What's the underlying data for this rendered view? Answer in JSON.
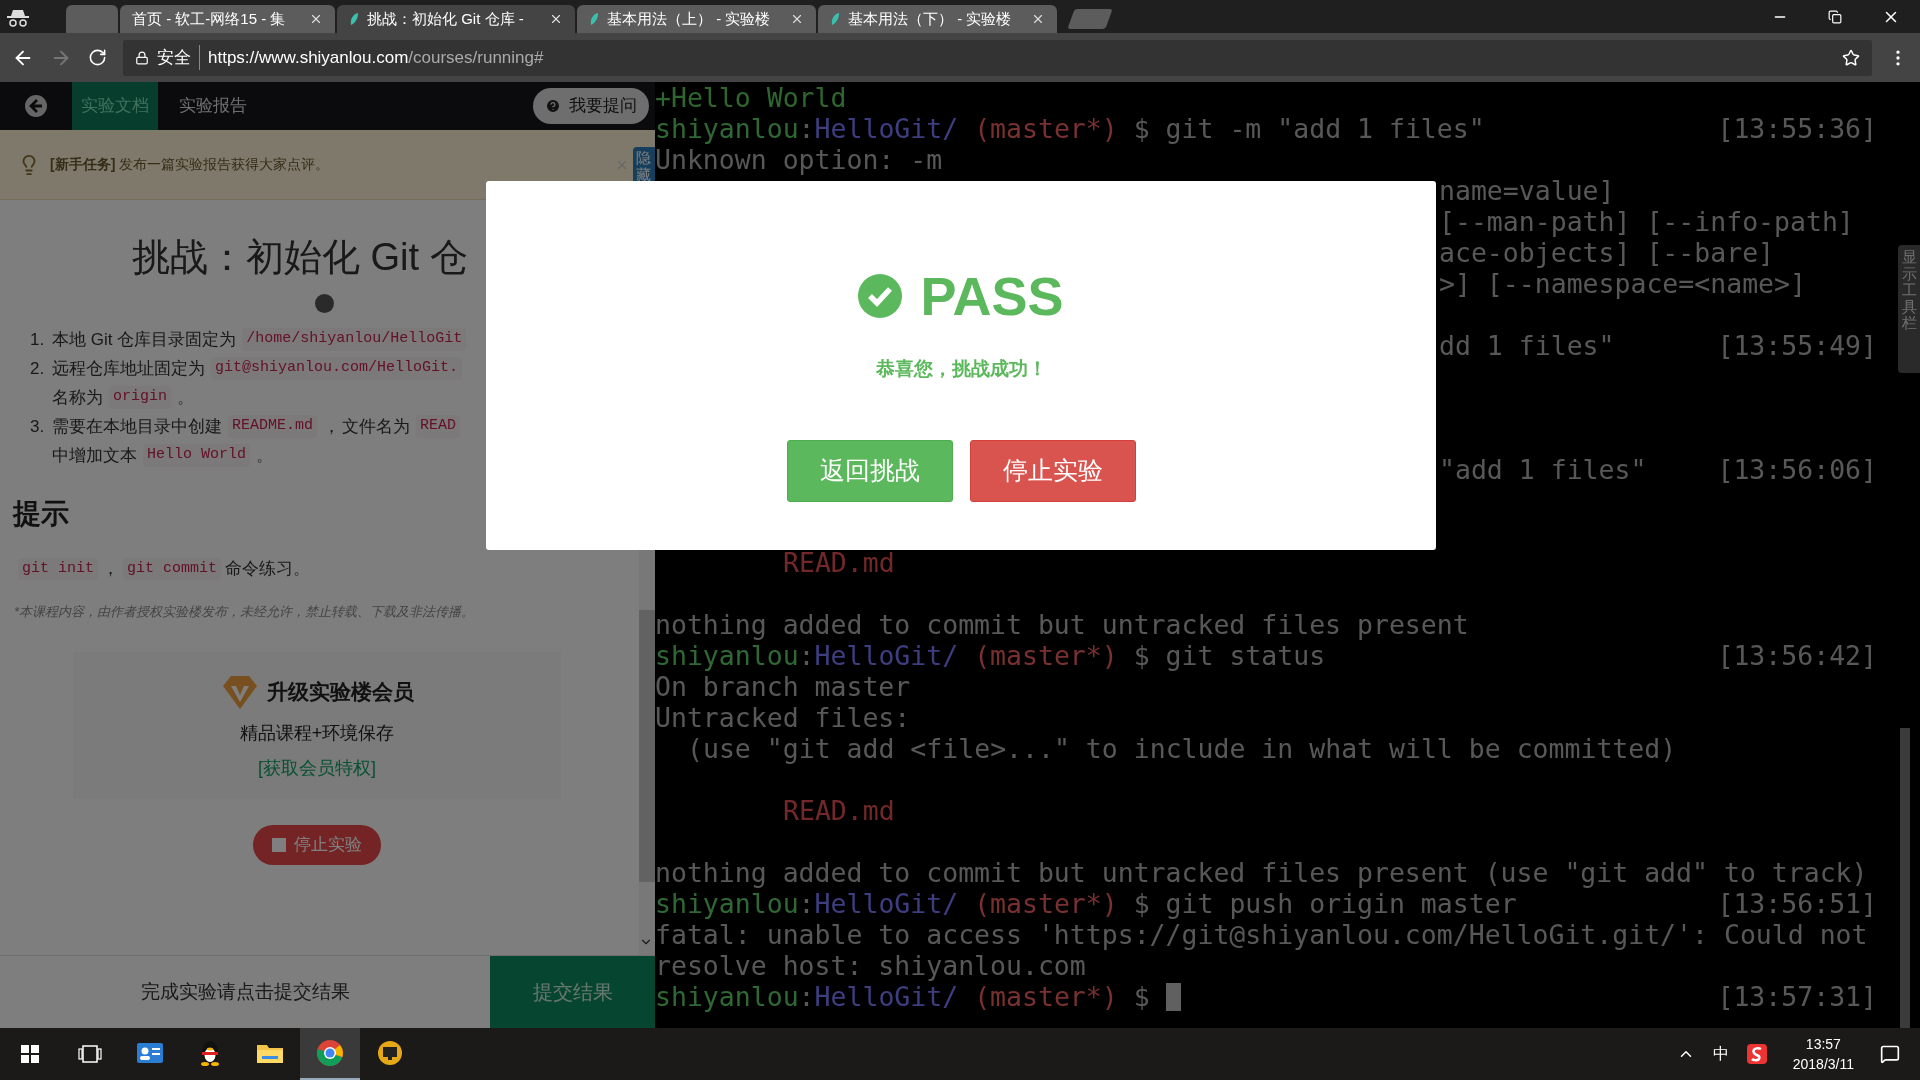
{
  "browser": {
    "tabs": [
      {
        "selected": false,
        "icon": false
      },
      {
        "title": "首页 - 软工-网络15 - 集",
        "selected": false,
        "icon": false
      },
      {
        "title": "挑战：初始化 Git 仓库 -",
        "selected": true,
        "icon": true
      },
      {
        "title": "基本用法（上） - 实验楼",
        "selected": false,
        "icon": true
      },
      {
        "title": "基本用法（下） - 实验楼",
        "selected": false,
        "icon": true
      }
    ],
    "forward_disabled": true,
    "security": "安全",
    "url_host": "https://www.shiyanlou.com",
    "url_path": "/courses/running#"
  },
  "lab_panel": {
    "nav_tabs": [
      {
        "label": "实验文档",
        "selected": true
      },
      {
        "label": "实验报告",
        "selected": false
      }
    ],
    "ask_button": "我要提问",
    "notice": "**[新手任务]** 发布一篇实验报告获得大家点评。",
    "hide_tab": "隐藏",
    "title": "挑战：初始化 Git 仓",
    "steps": [
      {
        "number": "1.",
        "lines": [
          [
            {
              "kind": "text",
              "text": "本地 Git 仓库目录固定为"
            },
            {
              "kind": "code",
              "text": "/home/shiyanlou/HelloGit"
            }
          ]
        ]
      },
      {
        "number": "2.",
        "lines": [
          [
            {
              "kind": "text",
              "text": "远程仓库地址固定为"
            },
            {
              "kind": "code",
              "text": "git@shiyanlou.com/HelloGit."
            }
          ],
          [
            {
              "kind": "text",
              "text": "名称为"
            },
            {
              "kind": "code",
              "text": "origin"
            },
            {
              "kind": "text",
              "text": "。"
            }
          ]
        ]
      },
      {
        "number": "3.",
        "lines": [
          [
            {
              "kind": "text",
              "text": "需要在本地目录中创建"
            },
            {
              "kind": "code",
              "text": "README.md"
            },
            {
              "kind": "text",
              "text": "，"
            },
            {
              "kind": "text",
              "text": "文件名为"
            },
            {
              "kind": "code",
              "text": "READ"
            }
          ],
          [
            {
              "kind": "text",
              "text": "中增加文本"
            },
            {
              "kind": "code",
              "text": "Hello World"
            },
            {
              "kind": "text",
              "text": "。"
            }
          ]
        ]
      }
    ],
    "tips_heading": "提示",
    "tips": [
      {
        "kind": "code",
        "text": "git init"
      },
      {
        "kind": "text",
        "text": "，"
      },
      {
        "kind": "code",
        "text": "git commit"
      },
      {
        "kind": "text",
        "text": "命令练习。"
      }
    ],
    "copyright": "*本课程内容，由作者授权实验楼发布，未经允许，禁止转载、下载及非法传播。",
    "member_card": {
      "title": "升级实验楼会员",
      "subtitle": "精品课程+环境保存",
      "link": "[获取会员特权]"
    },
    "stop_button": "停止实验",
    "footer": {
      "hint": "完成实验请点击提交结果",
      "submit": "提交结果"
    }
  },
  "terminal": {
    "lines": [
      {
        "kind": "added",
        "text": "+Hello World"
      },
      {
        "kind": "prompt",
        "user": "shiyanlou",
        "sep": ":",
        "dir": "HelloGit/",
        "branch": "(master*)",
        "command": "$ git -m \"add 1 files\"",
        "time": "[13:55:36]",
        "cursor": false
      },
      {
        "kind": "output",
        "text": "Unknown option: -m"
      },
      {
        "kind": "partial",
        "text": "name=value]"
      },
      {
        "kind": "partial",
        "text": "[--man-path] [--info-path]"
      },
      {
        "kind": "partial",
        "text": "ace-objects] [--bare]"
      },
      {
        "kind": "partial",
        "text": ">] [--namespace=<name>]"
      },
      {
        "kind": "blank"
      },
      {
        "kind": "partial",
        "text": "dd 1 files\"",
        "time": "[13:55:49]"
      },
      {
        "kind": "blank"
      },
      {
        "kind": "blank"
      },
      {
        "kind": "blank"
      },
      {
        "kind": "partial",
        "text": "\"add 1 files\"",
        "time": "[13:56:06]"
      },
      {
        "kind": "blank"
      },
      {
        "kind": "blank"
      },
      {
        "kind": "untracked",
        "text": "READ.md"
      },
      {
        "kind": "blank"
      },
      {
        "kind": "output",
        "text": "nothing added to commit but untracked files present"
      },
      {
        "kind": "prompt",
        "user": "shiyanlou",
        "sep": ":",
        "dir": "HelloGit/",
        "branch": "(master*)",
        "command": "$ git status",
        "time": "[13:56:42]",
        "cursor": false
      },
      {
        "kind": "output",
        "text": "On branch master"
      },
      {
        "kind": "output",
        "text": "Untracked files:"
      },
      {
        "kind": "hint",
        "text": "(use \"git add <file>...\" to include in what will be committed)"
      },
      {
        "kind": "blank"
      },
      {
        "kind": "untracked",
        "text": "READ.md"
      },
      {
        "kind": "blank"
      },
      {
        "kind": "output",
        "text": "nothing added to commit but untracked files present (use \"git add\" to track)"
      },
      {
        "kind": "prompt",
        "user": "shiyanlou",
        "sep": ":",
        "dir": "HelloGit/",
        "branch": "(master*)",
        "command": "$ git push origin master",
        "time": "[13:56:51]",
        "cursor": false
      },
      {
        "kind": "output",
        "text": "fatal: unable to access 'https://git@shiyanlou.com/HelloGit.git/': Could not"
      },
      {
        "kind": "output",
        "text": "resolve host: shiyanlou.com"
      },
      {
        "kind": "prompt",
        "user": "shiyanlou",
        "sep": ":",
        "dir": "HelloGit/",
        "branch": "(master*)",
        "command": "$",
        "time": "[13:57:31]",
        "cursor": true
      }
    ],
    "toolbar_tab": "显示工具栏"
  },
  "modal": {
    "status": "PASS",
    "message": "恭喜您，挑战成功！",
    "buttons": [
      {
        "label": "返回挑战",
        "kind": "primary"
      },
      {
        "label": "停止实验",
        "kind": "danger"
      }
    ]
  },
  "taskbar": {
    "apps": [
      {
        "kind": "contacts",
        "active": false
      },
      {
        "kind": "penguin",
        "active": false
      },
      {
        "kind": "folder",
        "active": false
      },
      {
        "kind": "browser",
        "active": true
      },
      {
        "kind": "monitor",
        "active": false
      }
    ],
    "ime": "中",
    "time": "13:57",
    "date": "2018/3/11"
  }
}
